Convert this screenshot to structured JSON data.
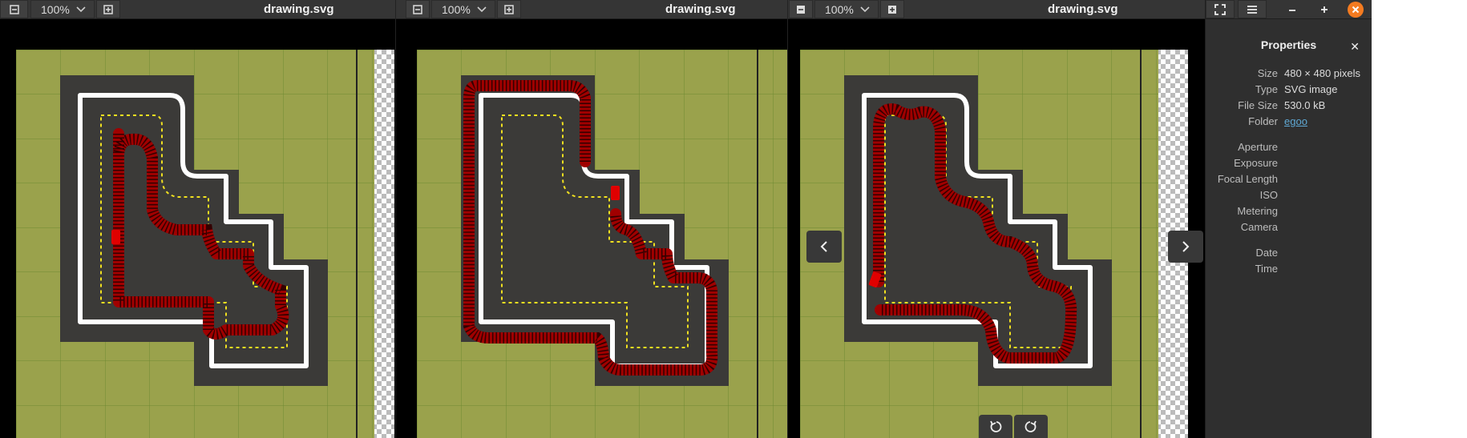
{
  "windows": [
    {
      "title": "drawing.svg",
      "zoom": "100%",
      "snake_head": "top-left column"
    },
    {
      "title": "drawing.svg",
      "zoom": "100%",
      "snake_head": "middle diagonal"
    },
    {
      "title": "drawing.svg",
      "zoom": "100%",
      "snake_head": "bottom-left corner"
    }
  ],
  "properties": {
    "heading": "Properties",
    "rows": [
      {
        "key": "Size",
        "value": "480 × 480 pixels"
      },
      {
        "key": "Type",
        "value": "SVG image"
      },
      {
        "key": "File Size",
        "value": "530.0 kB"
      },
      {
        "key": "Folder",
        "value": "egoo"
      },
      {
        "key": "Aperture",
        "value": ""
      },
      {
        "key": "Exposure",
        "value": ""
      },
      {
        "key": "Focal Length",
        "value": ""
      },
      {
        "key": "ISO",
        "value": ""
      },
      {
        "key": "Metering",
        "value": ""
      },
      {
        "key": "Camera",
        "value": ""
      },
      {
        "key": "Date",
        "value": ""
      },
      {
        "key": "Time",
        "value": ""
      }
    ]
  },
  "colors": {
    "grass": "#9aa24c",
    "grid": "#6e8a32",
    "road": "#3b3a38",
    "edge": "#ffffff",
    "center_line": "#f0e020",
    "snake": "#b00000",
    "close_accent": "#f47b20"
  },
  "icons": [
    "minus-icon",
    "chevron-down-icon",
    "plus-icon",
    "fullscreen-icon",
    "menu-icon",
    "minimize-icon",
    "maximize-icon",
    "close-icon",
    "chevron-left-icon",
    "chevron-right-icon",
    "rotate-left-icon",
    "rotate-right-icon"
  ]
}
